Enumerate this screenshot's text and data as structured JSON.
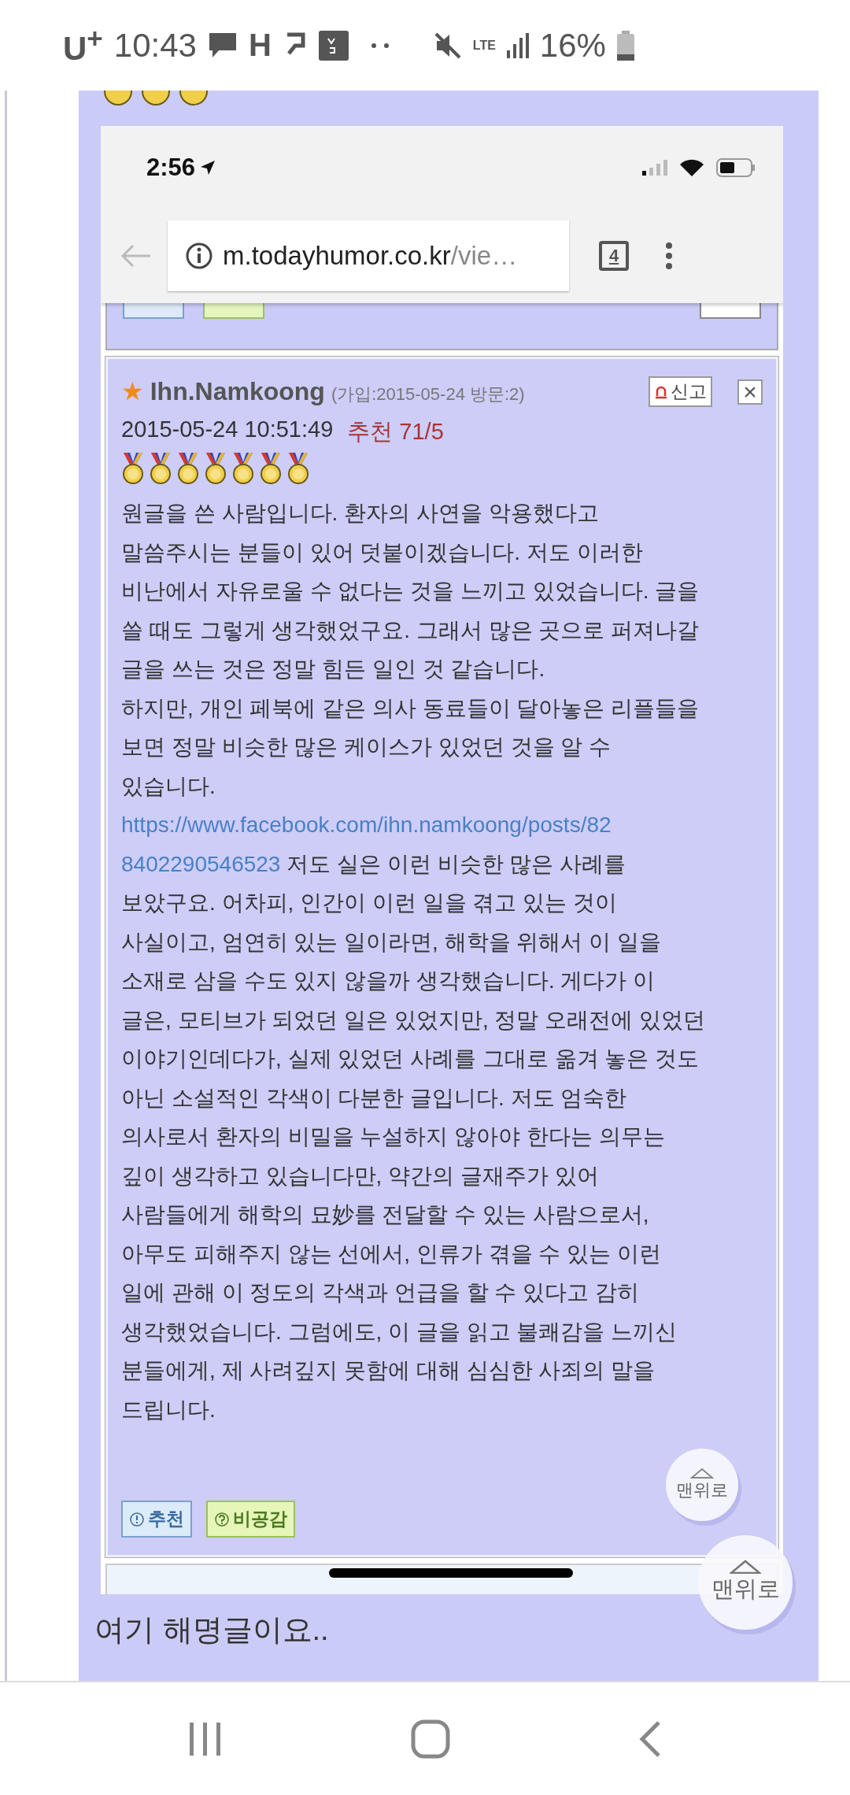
{
  "status_bar": {
    "carrier": "U$^{+}$",
    "time": "10:43",
    "h_label": "H",
    "network": "LTE",
    "battery": "16%"
  },
  "embedded_screenshot": {
    "status_bar": {
      "time": "2:56"
    },
    "address_bar": {
      "domain": "m.todayhumor.co.kr",
      "path": "/vie…",
      "tab_count": "4"
    },
    "comment": {
      "star": "★",
      "author": "Ihn.Namkoong",
      "meta": "(가입:2015-05-24 방문:2)",
      "report": "신고",
      "close": "×",
      "date": "2015-05-24 10:51:49",
      "recommend": "추천 71/5",
      "medals": [
        {
          "kind": "gold"
        },
        {
          "kind": "gold"
        },
        {
          "kind": "gold"
        },
        {
          "kind": "gold"
        },
        {
          "kind": "gold"
        },
        {
          "kind": "gold"
        },
        {
          "kind": "gold"
        }
      ],
      "paragraphs": [
        {
          "lines": [
            "원글을 쓴 사람입니다. 환자의 사연을 악용했다고",
            "말씀주시는 분들이 있어 덧붙이겠습니다. 저도 이러한",
            "비난에서 자유로울 수 없다는 것을 느끼고 있었습니다. 글을",
            "쓸 때도 그렇게 생각했었구요. 그래서 많은 곳으로 퍼져나갈",
            "글을 쓰는 것은 정말 힘든 일인 것 같습니다."
          ]
        },
        {
          "lines": [
            "하지만, 개인 페북에 같은 의사 동료들이 달아놓은 리플들을",
            "보면 정말 비슷한 많은 케이스가 있었던 것을 알 수",
            "있습니다."
          ]
        },
        {
          "link_lines": [
            "https://www.facebook.com/ihn.namkoong/posts/82",
            "8402290546523"
          ],
          "lines": [
            " 저도 실은 이런 비슷한 많은 사례를",
            "보았구요. 어차피, 인간이 이런 일을 겪고 있는 것이",
            "사실이고, 엄연히 있는 일이라면, 해학을 위해서 이 일을",
            "소재로 삼을 수도 있지 않을까 생각했습니다. 게다가 이",
            "글은, 모티브가 되었던 일은 있었지만, 정말 오래전에 있었던",
            "이야기인데다가, 실제 있었던 사례를 그대로 옮겨 놓은 것도",
            "아닌 소설적인 각색이 다분한 글입니다. 저도 엄숙한",
            "의사로서 환자의 비밀을 누설하지 않아야 한다는 의무는",
            "깊이 생각하고 있습니다만, 약간의 글재주가 있어",
            "사람들에게 해학의 묘妙를 전달할 수 있는 사람으로서,",
            "아무도 피해주지 않는 선에서, 인류가 겪을 수 있는 이런",
            "일에 관해 이 정도의 각색과 언급을 할 수 있다고 감히",
            "생각했었습니다. 그럼에도, 이 글을 읽고 불쾌감을 느끼신",
            "분들에게, 제 사려깊지 못함에 대해 심심한 사죄의 말을",
            "드립니다."
          ]
        }
      ],
      "buttons": [
        {
          "kind": "recommend",
          "label": "추천"
        },
        {
          "kind": "dislike",
          "label": "비공감"
        }
      ],
      "top_button": "맨위로"
    }
  },
  "caption": "여기 해명글이요..",
  "top_button": "맨위로"
}
